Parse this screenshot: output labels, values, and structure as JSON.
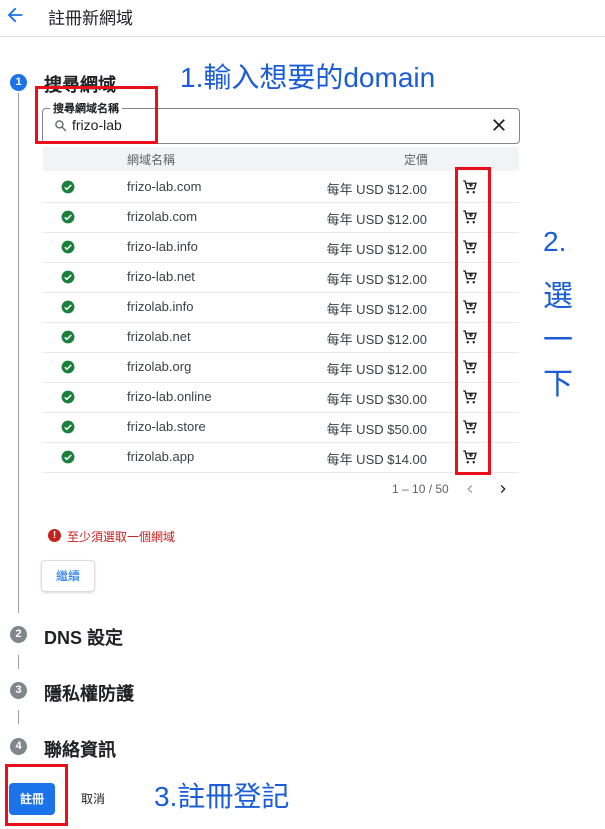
{
  "header": {
    "title": "註冊新網域",
    "back_icon": "arrow-back-icon"
  },
  "steps": [
    {
      "number": "1",
      "title": "搜尋網域"
    },
    {
      "number": "2",
      "title": "DNS 設定"
    },
    {
      "number": "3",
      "title": "隱私權防護"
    },
    {
      "number": "4",
      "title": "聯絡資訊"
    }
  ],
  "search": {
    "label": "搜尋網域名稱",
    "value": "frizo-lab"
  },
  "table": {
    "columns": [
      "網域名稱",
      "定價"
    ],
    "rows": [
      {
        "domain": "frizo-lab.com",
        "price": "每年 USD $12.00"
      },
      {
        "domain": "frizolab.com",
        "price": "每年 USD $12.00"
      },
      {
        "domain": "frizo-lab.info",
        "price": "每年 USD $12.00"
      },
      {
        "domain": "frizo-lab.net",
        "price": "每年 USD $12.00"
      },
      {
        "domain": "frizolab.info",
        "price": "每年 USD $12.00"
      },
      {
        "domain": "frizolab.net",
        "price": "每年 USD $12.00"
      },
      {
        "domain": "frizolab.org",
        "price": "每年 USD $12.00"
      },
      {
        "domain": "frizo-lab.online",
        "price": "每年 USD $30.00"
      },
      {
        "domain": "frizo-lab.store",
        "price": "每年 USD $50.00"
      },
      {
        "domain": "frizolab.app",
        "price": "每年 USD $14.00"
      }
    ]
  },
  "pagination": {
    "range": "1 – 10 / 50"
  },
  "error": {
    "message": "至少須選取一個網域"
  },
  "buttons": {
    "continue": "繼續",
    "register": "註冊",
    "cancel": "取消"
  },
  "annotations": {
    "step1": "1.輸入想要的domain",
    "step2_line1": "2.",
    "step2_line2": "選",
    "step2_line3": "一",
    "step2_line4": "下",
    "step3": "3.註冊登記"
  },
  "colors": {
    "accent": "#1a73e8",
    "success": "#188038",
    "error": "#c5221f",
    "annotation_box": "#e8101a",
    "annotation_text": "#1a5dd6"
  }
}
